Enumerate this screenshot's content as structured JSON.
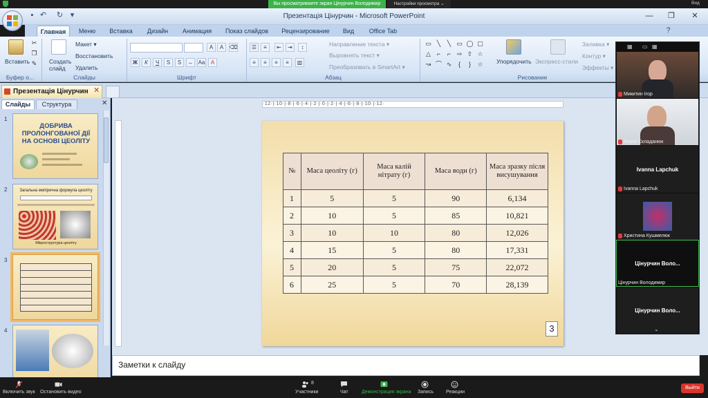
{
  "zoom_top": {
    "share_banner": "Вы просматриваете экран Цінурчин Володимир",
    "view_options": "Настройки просмотра ⌄",
    "view_label": "Вид"
  },
  "window": {
    "title": "Презентація Цінурчин - Microsoft PowerPoint",
    "minimize": "—",
    "restore": "❐",
    "close": "✕"
  },
  "ribbon_tabs": [
    "Главная",
    "Меню",
    "Вставка",
    "Дизайн",
    "Анимация",
    "Показ слайдов",
    "Рецензирование",
    "Вид",
    "Office Tab"
  ],
  "ribbon": {
    "paste": "Вставить",
    "clipboard_label": "Буфер о...",
    "new_slide": "Создать слайд",
    "layout": "Макет ▾",
    "reset": "Восстановить",
    "delete": "Удалить",
    "slides_label": "Слайды",
    "font_label": "Шрифт",
    "text_direction": "Направление текста ▾",
    "align_text": "Выровнять текст ▾",
    "smartart": "Преобразовать в SmartArt ▾",
    "paragraph_label": "Абзац",
    "arrange": "Упорядочить",
    "quick_styles": "Экспресс-стили",
    "fill": "Заливка ▾",
    "outline": "Контур ▾",
    "effects": "Эффекты ▾",
    "drawing_label": "Рисование"
  },
  "doc_tab": {
    "name": "Презентація Цінурчин",
    "close": "✕"
  },
  "left_panel": {
    "tab_slides": "Слайды",
    "tab_outline": "Структура",
    "close": "✕"
  },
  "thumbnails": {
    "n1": "1",
    "n2": "2",
    "n3": "3",
    "n4": "4",
    "t1_title": "ДОБРИВА ПРОЛОНГОВАНОЇ ДІЇ НА ОСНОВІ ЦЕОЛІТУ",
    "t2_title": "Загальна емпірична формула цеоліту",
    "t2_caption": "Мікроструктура цеоліту"
  },
  "ruler": {
    "h": "·12·|·10·|·8·|·6·|·4·|·2·|·0·|·2·|·4·|·6·|·8·|·10·|·12·"
  },
  "slide": {
    "headers": [
      "№",
      "Маса цеоліту (г)",
      "Маса  калій нітрату (г)",
      "Маса води (г)",
      "Маса зразку після висушування"
    ],
    "rows": [
      [
        "1",
        "5",
        "5",
        "90",
        "6,134"
      ],
      [
        "2",
        "10",
        "5",
        "85",
        "10,821"
      ],
      [
        "3",
        "10",
        "10",
        "80",
        "12,026"
      ],
      [
        "4",
        "15",
        "5",
        "80",
        "17,331"
      ],
      [
        "5",
        "20",
        "5",
        "75",
        "22,072"
      ],
      [
        "6",
        "25",
        "5",
        "70",
        "28,139"
      ]
    ],
    "page_number": "3"
  },
  "notes": {
    "placeholder": "Заметки к слайду"
  },
  "participants": [
    {
      "name": "Микитин Ігор"
    },
    {
      "name": "Марія Складанюк"
    },
    {
      "name": "Ivanna Lapchuk",
      "display": "Ivanna Lapchuk"
    },
    {
      "name": "Христина Кушмелюк"
    },
    {
      "name": "Цінурчин Володимир",
      "display": "Цінурчин  Воло..."
    },
    {
      "display": "Цінурчин  Воло..."
    }
  ],
  "zoom_bottom": {
    "mute": "Включить звук",
    "video": "Остановить видео",
    "participants": "Участники",
    "participants_count": "8",
    "chat": "Чат",
    "share": "Демонстрация экрана",
    "record": "Запись",
    "reactions": "Реакции",
    "leave": "Выйти"
  },
  "colors": {
    "zoom_green": "#3cb34a",
    "leave_red": "#d9342b",
    "ribbon_blue": "#bfd3ec",
    "slide_bg": "#f3deab"
  }
}
